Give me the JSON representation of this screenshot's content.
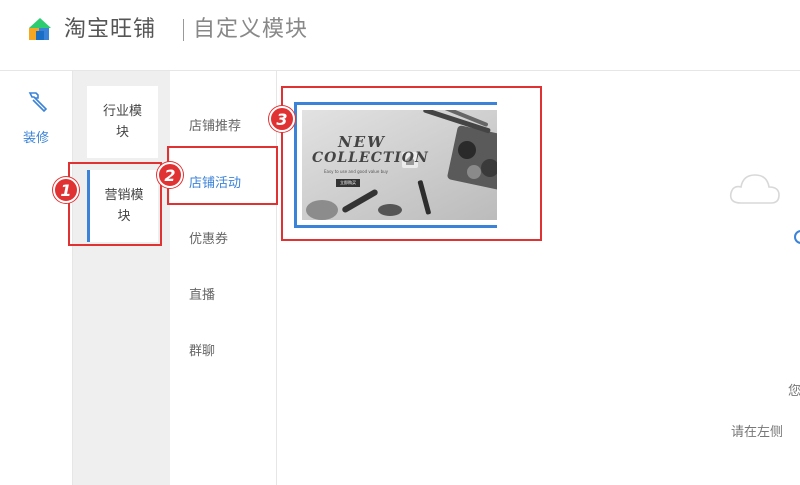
{
  "header": {
    "brand": "淘宝旺铺",
    "subtitle": "自定义模块"
  },
  "left_rail": {
    "label": "装修"
  },
  "categories": [
    {
      "label": "行业模块",
      "active": false
    },
    {
      "label": "营销模块",
      "active": true
    }
  ],
  "sub_items": [
    {
      "label": "店铺推荐",
      "active": false
    },
    {
      "label": "店铺活动",
      "active": true
    },
    {
      "label": "优惠券",
      "active": false
    },
    {
      "label": "直播",
      "active": false
    },
    {
      "label": "群聊",
      "active": false
    }
  ],
  "template": {
    "headline_line1": "NEW",
    "headline_line2": "COLLECTION",
    "tagline": "Easy to use and good value buy",
    "button": "立即购买"
  },
  "right_area": {
    "hint1": "您",
    "hint2": "请在左侧"
  },
  "annotations": {
    "badge1": "1",
    "badge2": "2",
    "badge3": "3"
  },
  "colors": {
    "accent": "#3b83d8",
    "annotation_red": "#e13233",
    "panel_bg": "#efefef"
  }
}
